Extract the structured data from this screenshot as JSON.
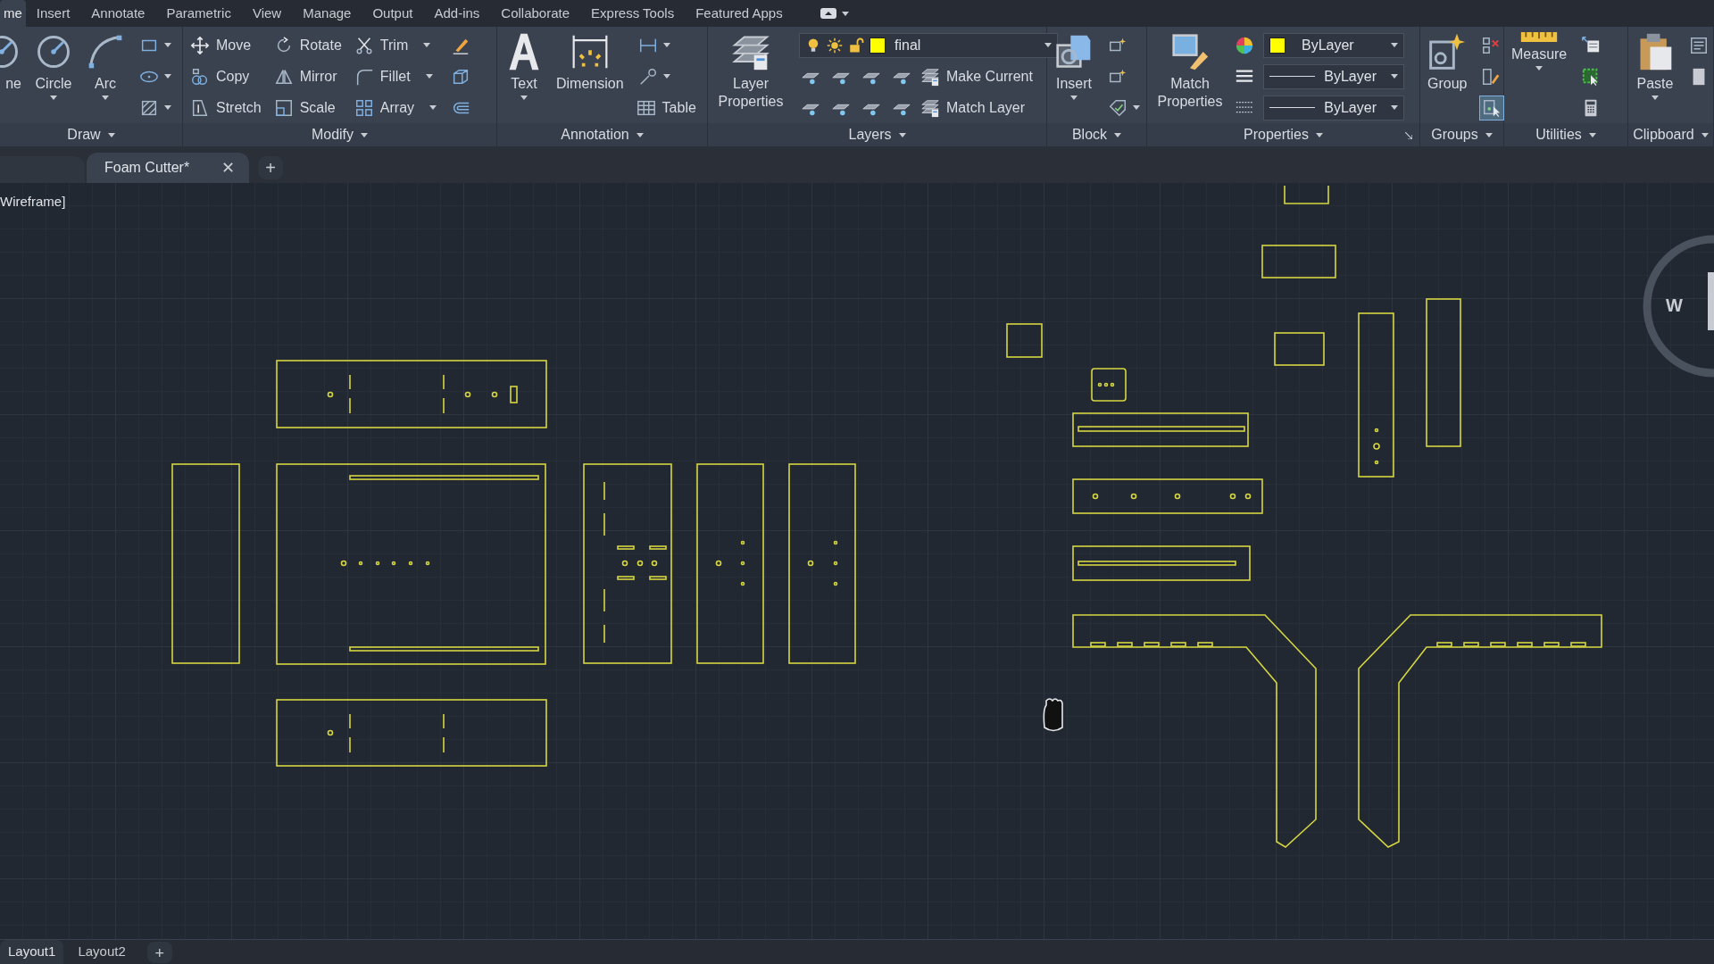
{
  "menu_tabs": [
    {
      "label": "me",
      "selected": true
    },
    {
      "label": "Insert",
      "selected": false
    },
    {
      "label": "Annotate",
      "selected": false
    },
    {
      "label": "Parametric",
      "selected": false
    },
    {
      "label": "View",
      "selected": false
    },
    {
      "label": "Manage",
      "selected": false
    },
    {
      "label": "Output",
      "selected": false
    },
    {
      "label": "Add-ins",
      "selected": false
    },
    {
      "label": "Collaborate",
      "selected": false
    },
    {
      "label": "Express Tools",
      "selected": false
    },
    {
      "label": "Featured Apps",
      "selected": false
    }
  ],
  "ribbon": {
    "groups": [
      {
        "label": "Draw",
        "launcher": false,
        "columns": [
          [
            [
              {
                "kind": "large",
                "label": "ne",
                "has_menu": false
              }
            ]
          ],
          [
            [
              {
                "kind": "large",
                "label": "Circle",
                "has_menu": true
              }
            ]
          ],
          [
            [
              {
                "kind": "large",
                "label": "Arc",
                "has_menu": true
              }
            ]
          ],
          [
            [
              {
                "kind": "icon",
                "has_menu": true
              }
            ],
            [
              {
                "kind": "icon",
                "has_menu": true
              }
            ],
            [
              {
                "kind": "icon",
                "has_menu": true
              }
            ]
          ]
        ]
      },
      {
        "label": "Modify",
        "launcher": false,
        "columns": [
          [
            [
              {
                "kind": "small",
                "label": "Move",
                "has_menu": false
              }
            ],
            [
              {
                "kind": "small",
                "label": "Copy",
                "has_menu": false
              }
            ],
            [
              {
                "kind": "small",
                "label": "Stretch",
                "has_menu": false
              }
            ]
          ],
          [
            [
              {
                "kind": "small",
                "label": "Rotate",
                "has_menu": false
              }
            ],
            [
              {
                "kind": "small",
                "label": "Mirror",
                "has_menu": false
              }
            ],
            [
              {
                "kind": "small",
                "label": "Scale",
                "has_menu": false
              }
            ]
          ],
          [
            [
              {
                "kind": "small",
                "label": "Trim",
                "has_menu": true
              }
            ],
            [
              {
                "kind": "small",
                "label": "Fillet",
                "has_menu": true
              }
            ],
            [
              {
                "kind": "small",
                "label": "Array",
                "has_menu": true
              }
            ]
          ],
          [
            [
              {
                "kind": "icon",
                "has_menu": false
              }
            ],
            [
              {
                "kind": "icon",
                "has_menu": false
              }
            ],
            [
              {
                "kind": "icon",
                "has_menu": false
              }
            ]
          ]
        ]
      },
      {
        "label": "Annotation",
        "launcher": false,
        "columns": [
          [
            [
              {
                "kind": "large",
                "label": "Text",
                "has_menu": true
              }
            ]
          ],
          [
            [
              {
                "kind": "large",
                "label": "Dimension",
                "has_menu": false
              }
            ]
          ],
          [
            [
              {
                "kind": "icon",
                "has_menu": true
              }
            ],
            [
              {
                "kind": "icon",
                "has_menu": true
              }
            ],
            [
              {
                "kind": "small",
                "label": "Table",
                "has_menu": false
              }
            ]
          ]
        ]
      },
      {
        "label": "Layers",
        "launcher": false,
        "columns": [
          [
            [
              {
                "kind": "large",
                "label": "Layer Properties",
                "has_menu": false
              }
            ]
          ],
          [
            [
              {
                "kind": "layer-combo",
                "label": "final",
                "color": "#ffff00",
                "has_menu": true
              }
            ],
            [
              {
                "kind": "icon",
                "has_menu": false
              },
              {
                "kind": "icon",
                "has_menu": false
              },
              {
                "kind": "icon",
                "has_menu": false
              },
              {
                "kind": "icon",
                "has_menu": false
              },
              {
                "kind": "small",
                "label": "Make Current",
                "has_menu": false
              }
            ],
            [
              {
                "kind": "icon",
                "has_menu": false
              },
              {
                "kind": "icon",
                "has_menu": false
              },
              {
                "kind": "icon",
                "has_menu": false
              },
              {
                "kind": "icon",
                "has_menu": false
              },
              {
                "kind": "small",
                "label": "Match Layer",
                "has_menu": false
              }
            ]
          ]
        ]
      },
      {
        "label": "Block",
        "launcher": false,
        "columns": [
          [
            [
              {
                "kind": "large",
                "label": "Insert",
                "has_menu": true
              }
            ]
          ],
          [
            [
              {
                "kind": "icon",
                "has_menu": false
              }
            ],
            [
              {
                "kind": "icon",
                "has_menu": false
              }
            ],
            [
              {
                "kind": "icon",
                "has_menu": true
              }
            ]
          ]
        ]
      },
      {
        "label": "Properties",
        "launcher": true,
        "columns": [
          [
            [
              {
                "kind": "large",
                "label": "Match Properties",
                "has_menu": false
              }
            ]
          ],
          [
            [
              {
                "kind": "icon",
                "has_menu": false
              }
            ],
            [
              {
                "kind": "icon",
                "has_menu": false
              }
            ],
            [
              {
                "kind": "icon",
                "has_menu": false
              }
            ]
          ],
          [
            [
              {
                "kind": "combo",
                "label": "ByLayer",
                "color": "#ffff00",
                "has_menu": true
              }
            ],
            [
              {
                "kind": "line-combo",
                "label": "ByLayer",
                "has_menu": true
              }
            ],
            [
              {
                "kind": "line-combo",
                "label": "ByLayer",
                "has_menu": true
              }
            ]
          ]
        ]
      },
      {
        "label": "Groups",
        "launcher": false,
        "columns": [
          [
            [
              {
                "kind": "large",
                "label": "Group",
                "has_menu": false
              }
            ]
          ],
          [
            [
              {
                "kind": "icon",
                "has_menu": false,
                "on": false
              }
            ],
            [
              {
                "kind": "icon",
                "has_menu": false,
                "on": false
              }
            ],
            [
              {
                "kind": "icon",
                "has_menu": false,
                "on": true
              }
            ]
          ]
        ]
      },
      {
        "label": "Utilities",
        "launcher": false,
        "columns": [
          [
            [
              {
                "kind": "large",
                "label": "Measure",
                "has_menu": true
              }
            ]
          ],
          [
            [
              {
                "kind": "icon",
                "has_menu": false
              }
            ],
            [
              {
                "kind": "icon",
                "has_menu": false
              }
            ],
            [
              {
                "kind": "icon",
                "has_menu": false
              }
            ]
          ]
        ]
      },
      {
        "label": "Clipboard",
        "launcher": false,
        "columns": [
          [
            [
              {
                "kind": "large",
                "label": "Paste",
                "has_menu": true
              }
            ]
          ],
          [
            [
              {
                "kind": "icon",
                "has_menu": false
              }
            ],
            [
              {
                "kind": "icon",
                "has_menu": false
              }
            ]
          ]
        ]
      }
    ]
  },
  "file_tabs": [
    {
      "label": "Foam Cutter*",
      "close": "✕",
      "selected": true
    }
  ],
  "new_tab": "+",
  "viewport_label": "Wireframe]",
  "viewcube": {
    "label": "W"
  },
  "layout_tabs": [
    {
      "label": "Layout1",
      "selected": true
    },
    {
      "label": "Layout2",
      "selected": false
    }
  ],
  "new_layout": "+"
}
